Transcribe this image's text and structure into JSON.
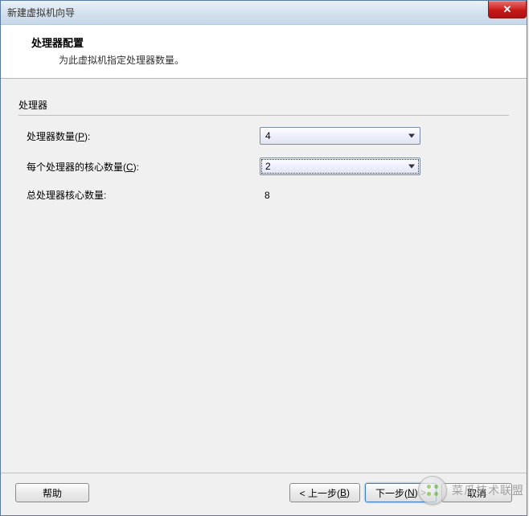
{
  "window": {
    "title": "新建虚拟机向导",
    "close_label": "✕"
  },
  "header": {
    "title": "处理器配置",
    "subtitle": "为此虚拟机指定处理器数量。"
  },
  "form": {
    "legend": "处理器",
    "processor_count_label_pre": "处理器数量(",
    "processor_count_mnemonic": "P",
    "processor_count_label_post": "):",
    "processor_count_value": "4",
    "cores_per_label_pre": "每个处理器的核心数量(",
    "cores_per_mnemonic": "C",
    "cores_per_label_post": "):",
    "cores_per_value": "2",
    "total_label": "总处理器核心数量:",
    "total_value": "8"
  },
  "footer": {
    "help": "帮助",
    "back_pre": "< 上一步(",
    "back_mn": "B",
    "back_post": ")",
    "next_pre": "下一步(",
    "next_mn": "N",
    "next_post": ") >",
    "cancel": "取消"
  },
  "watermark": {
    "text": "菜瓜技术联盟"
  }
}
